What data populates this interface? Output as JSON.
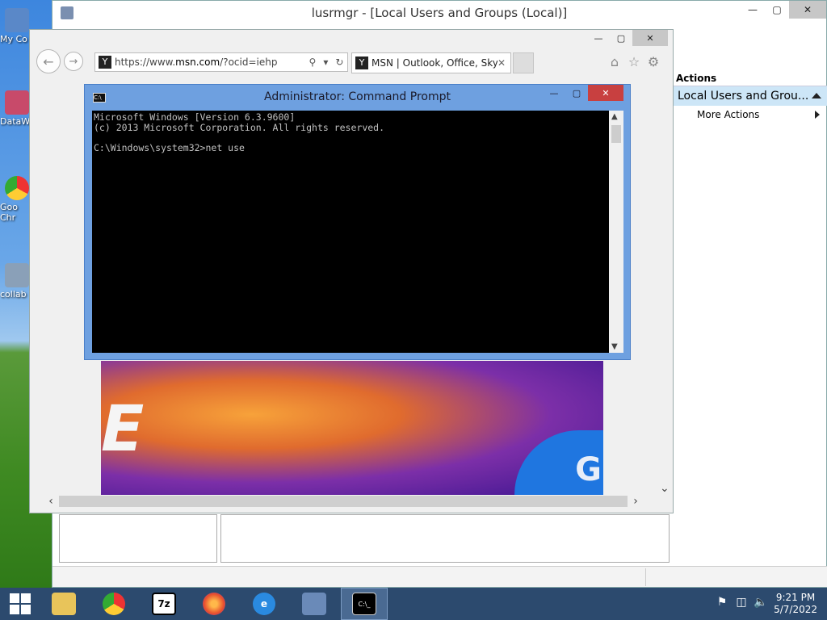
{
  "desktop": {
    "icons": [
      {
        "label": "My Co"
      },
      {
        "label": "DataW"
      },
      {
        "label": "Goo Chr"
      },
      {
        "label": "collab"
      }
    ]
  },
  "mmc": {
    "title": "lusrmgr - [Local Users and Groups (Local)]",
    "actions_header": "Actions",
    "actions_item": "Local Users and Grou...",
    "actions_sub": "More Actions"
  },
  "ie": {
    "url_prefix": "https://www.",
    "url_domain": "msn.com",
    "url_suffix": "/?ocid=iehp",
    "tab_title": "MSN | Outlook, Office, Sky...",
    "content_letters": "E",
    "content_blob_letter": "G"
  },
  "cmd": {
    "title": "Administrator: Command Prompt",
    "lines": "Microsoft Windows [Version 6.3.9600]\n(c) 2013 Microsoft Corporation. All rights reserved.\n\nC:\\Windows\\system32>net use"
  },
  "taskbar": {
    "seven_zip": "7z",
    "cmd_label": "C:\\_",
    "time": "9:21 PM",
    "date": "5/7/2022"
  },
  "colors": {
    "cmd_title_bg": "#6ea0e0",
    "cmd_close": "#c84040",
    "taskbar_bg": "#2c4a6e",
    "actions_highlight": "#cde6f7"
  }
}
